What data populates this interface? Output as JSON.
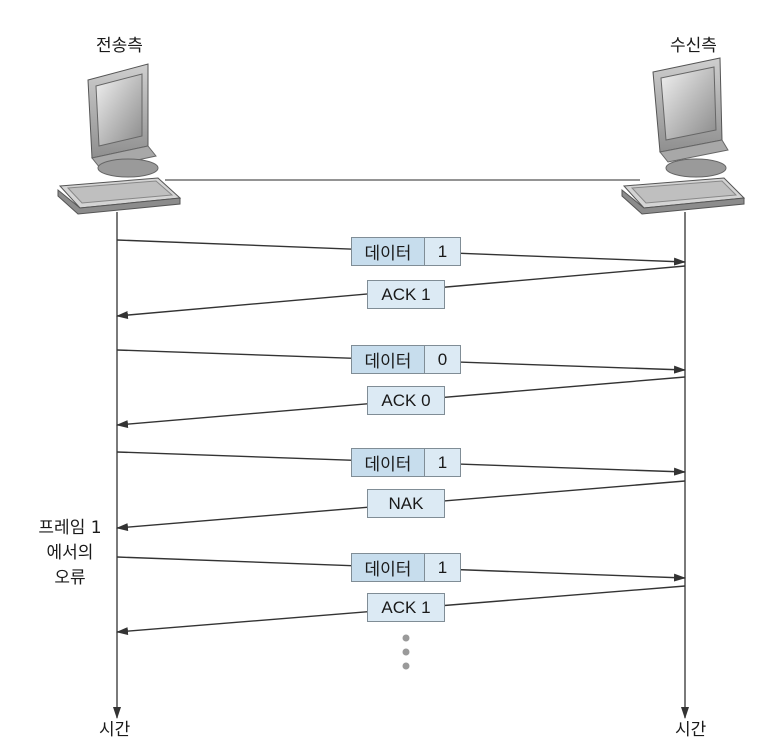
{
  "sender": {
    "label": "전송측",
    "icon": "computer-icon"
  },
  "receiver": {
    "label": "수신측",
    "icon": "computer-icon"
  },
  "time_label_left": "시간",
  "time_label_right": "시간",
  "error_note": [
    "프레임 1",
    "에서의",
    "오류"
  ],
  "exchanges": [
    {
      "data_label": "데이터",
      "data_seq": "1",
      "reply": "ACK 1"
    },
    {
      "data_label": "데이터",
      "data_seq": "0",
      "reply": "ACK 0"
    },
    {
      "data_label": "데이터",
      "data_seq": "1",
      "reply": "NAK"
    },
    {
      "data_label": "데이터",
      "data_seq": "1",
      "reply": "ACK 1"
    }
  ],
  "colors": {
    "box_fill": "#dceaf4",
    "box_border": "#808d96",
    "line": "#333333"
  }
}
